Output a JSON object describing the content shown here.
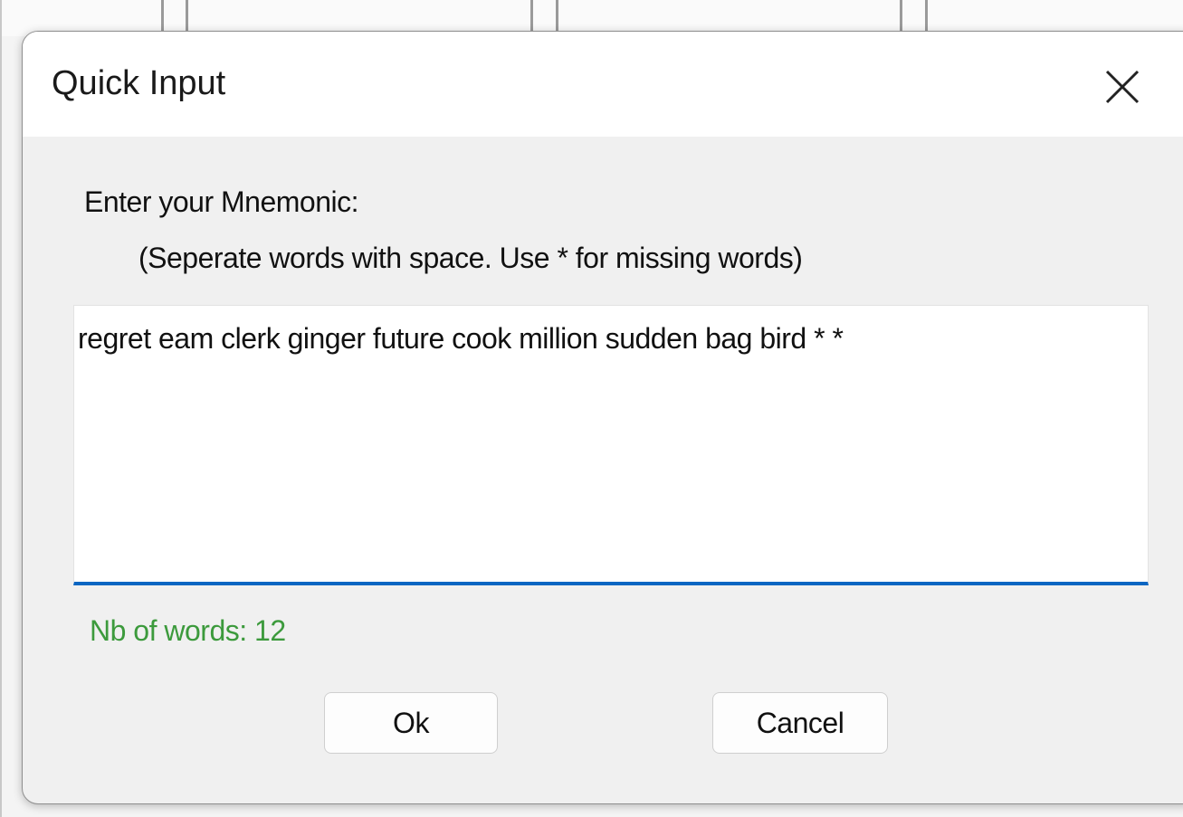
{
  "dialog": {
    "title": "Quick Input",
    "close_icon": "close-icon",
    "prompt_label": "Enter your Mnemonic:",
    "prompt_hint": "(Seperate words with space. Use * for missing words)",
    "mnemonic_value": "regret eam clerk ginger future cook million sudden bag bird * *",
    "word_count_text": "Nb of words: 12",
    "ok_label": "Ok",
    "cancel_label": "Cancel"
  },
  "colors": {
    "accent_underline": "#0a66c2",
    "word_count_text": "#3c9a3c",
    "dialog_background": "#f0f0f0",
    "titlebar_background": "#ffffff"
  }
}
